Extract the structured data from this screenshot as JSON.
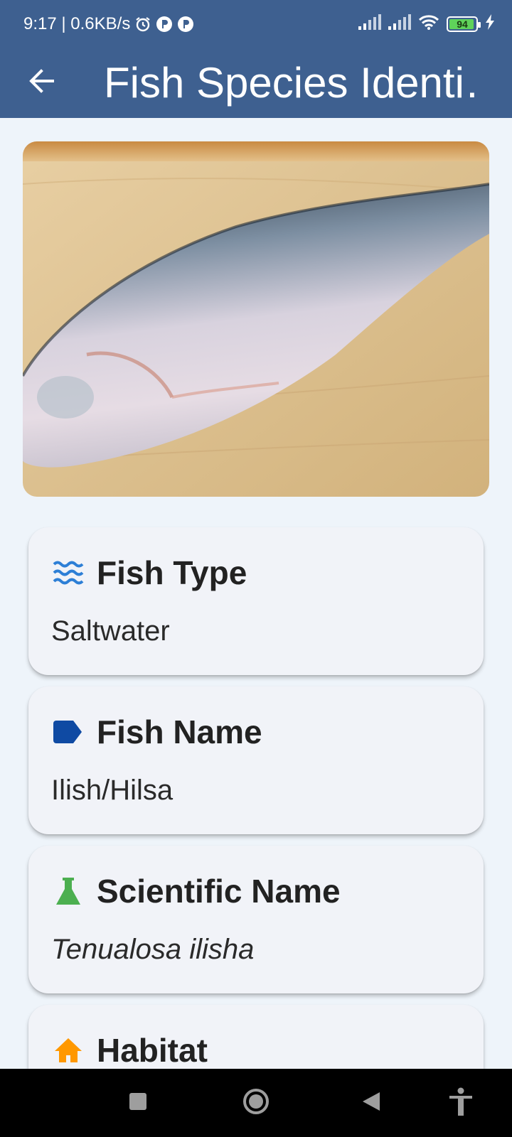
{
  "status_bar": {
    "time_speed": "9:17 | 0.6KB/s",
    "battery_level": "94",
    "battery_fraction": 0.94,
    "icons": [
      "alarm-icon",
      "app-notification-icon",
      "app-notification-icon",
      "signal-icon",
      "signal-icon",
      "wifi-icon",
      "battery-icon",
      "charging-icon"
    ]
  },
  "app_bar": {
    "title": "Fish Species Identi…",
    "back_icon": "arrow-back-icon",
    "background": "#3e6090"
  },
  "image": {
    "subject": "fish-photo"
  },
  "cards": [
    {
      "icon": "waves-icon",
      "icon_color": "#2d7fd6",
      "title": "Fish Type",
      "value": "Saltwater"
    },
    {
      "icon": "label-icon",
      "icon_color": "#0f4aa3",
      "title": "Fish Name",
      "value": "Ilish/Hilsa"
    },
    {
      "icon": "flask-icon",
      "icon_color": "#4caf50",
      "title": "Scientific Name",
      "value": "Tenualosa ilisha"
    },
    {
      "icon": "home-icon",
      "icon_color": "#ff9800",
      "title": "Habitat",
      "value": ""
    }
  ],
  "nav_bar": {
    "buttons": [
      "recents-button",
      "home-button",
      "back-button",
      "accessibility-button"
    ]
  }
}
